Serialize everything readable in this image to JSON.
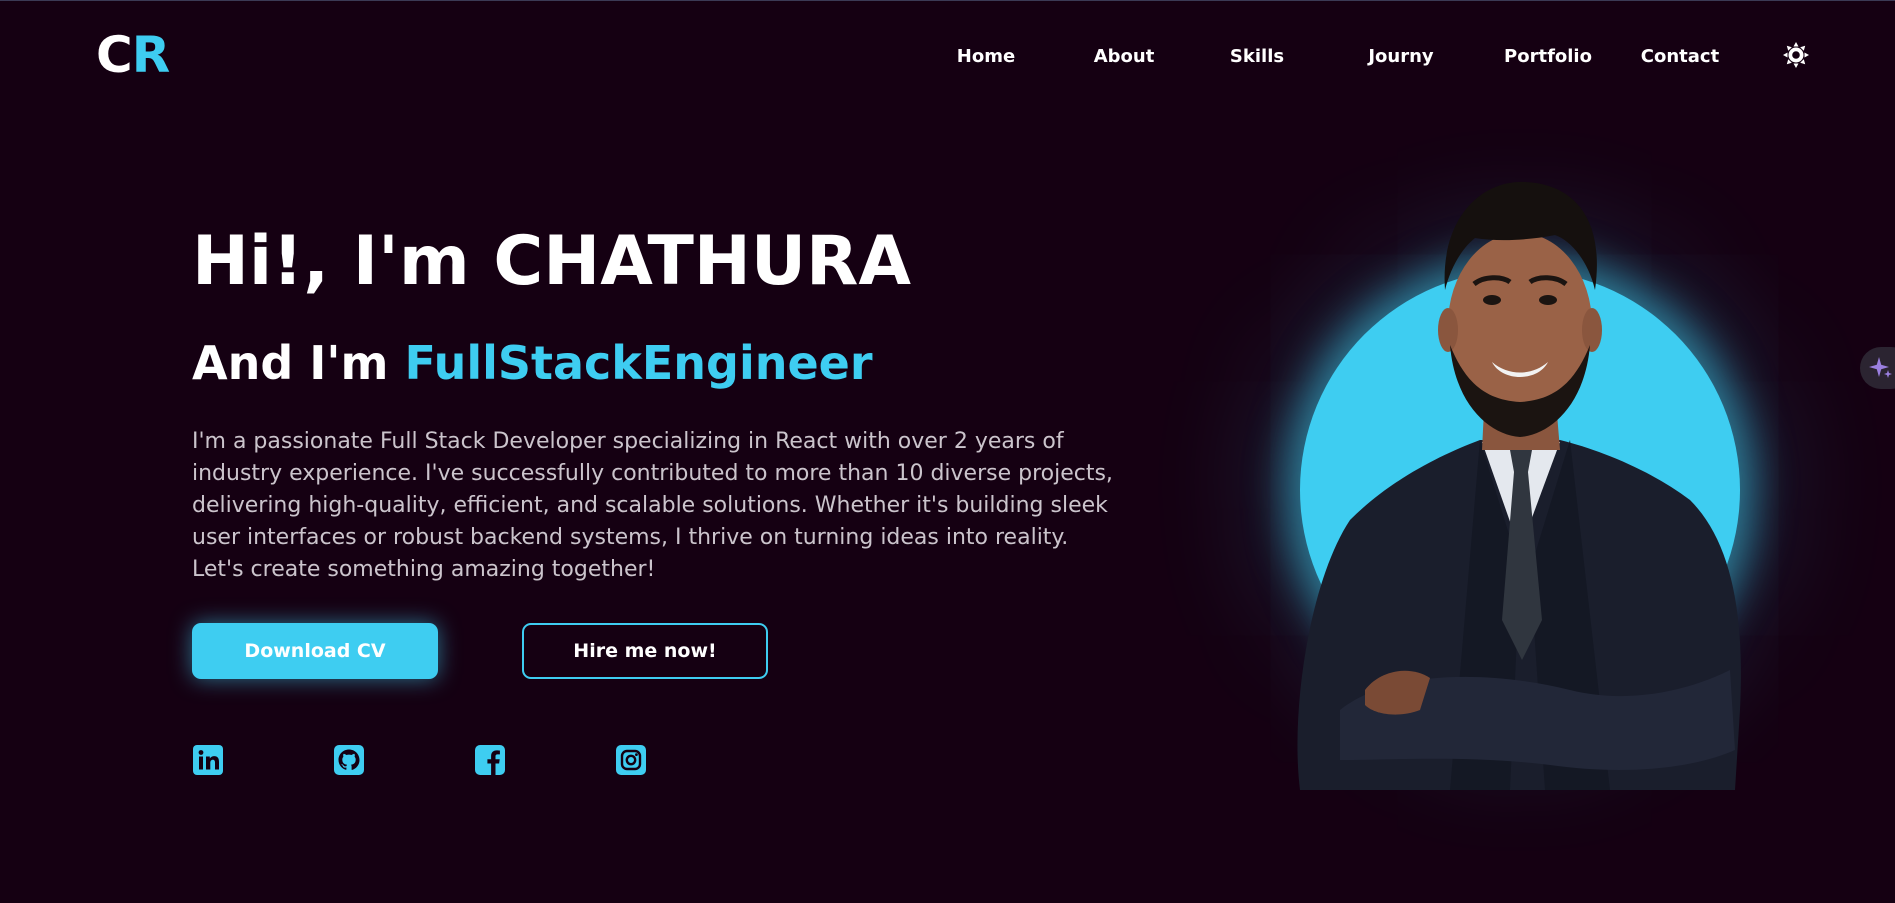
{
  "logo": {
    "first": "C",
    "second": "R"
  },
  "nav": {
    "items": [
      {
        "label": "Home"
      },
      {
        "label": "About"
      },
      {
        "label": "Skills"
      },
      {
        "label": "Journy"
      },
      {
        "label": "Portfolio"
      },
      {
        "label": "Contact"
      }
    ],
    "theme_toggle_icon": "sun-icon"
  },
  "hero": {
    "title": "Hi!, I'm CHATHURA",
    "subtitle_prefix": "And I'm ",
    "subtitle_highlight": "FullStackEngineer",
    "description": "I'm a passionate Full Stack Developer specializing in React with over 2 years of industry experience. I've successfully contributed to more than 10 diverse projects, delivering high-quality, efficient, and scalable solutions. Whether it's building sleek user interfaces or robust backend systems, I thrive on turning ideas into reality. Let's create something amazing together!",
    "download_cv_label": "Download CV",
    "hire_label": "Hire me now!"
  },
  "socials": [
    {
      "icon": "linkedin-icon"
    },
    {
      "icon": "github-icon"
    },
    {
      "icon": "facebook-icon"
    },
    {
      "icon": "instagram-icon"
    }
  ],
  "side_widget": {
    "icon": "sparkle-icon"
  },
  "colors": {
    "background": "#150012",
    "accent": "#3ecdf1",
    "text": "#ffffff",
    "muted_text": "#cbc4cc"
  }
}
